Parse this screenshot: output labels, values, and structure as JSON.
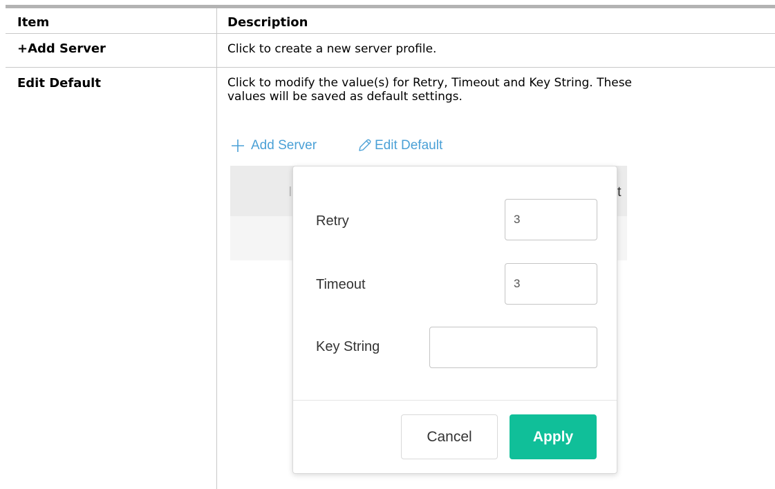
{
  "table": {
    "headers": {
      "item": "Item",
      "description": "Description"
    },
    "rows": [
      {
        "item": "+Add Server",
        "description": "Click to create a new server profile."
      },
      {
        "item": "Edit Default",
        "description_lines": [
          "Click to modify the value(s) for Retry, Timeout and Key String. These",
          "values will be saved as default settings."
        ]
      }
    ]
  },
  "figure": {
    "toolbar": {
      "add_label": "Add Server",
      "add_icon": "plus-icon",
      "edit_label": "Edit Default",
      "edit_icon": "pencil-icon",
      "link_color": "#4aa0d6"
    },
    "background_table": {
      "header_fragment_left": "I",
      "header_fragment_right": "t"
    },
    "dialog": {
      "fields": [
        {
          "label": "Retry",
          "value": "3"
        },
        {
          "label": "Timeout",
          "value": "3"
        },
        {
          "label": "Key String",
          "value": ""
        }
      ],
      "cancel_label": "Cancel",
      "apply_label": "Apply",
      "apply_color": "#10bf99"
    }
  }
}
